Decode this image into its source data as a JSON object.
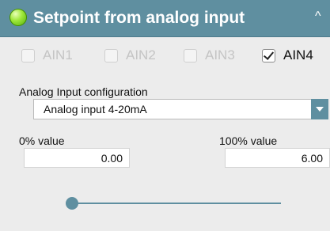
{
  "header": {
    "title": "Setpoint from analog input",
    "status_color": "#8fd82a",
    "collapse_icon": "chevron-up-icon"
  },
  "inputs": [
    {
      "label": "AIN1",
      "checked": false
    },
    {
      "label": "AIN2",
      "checked": false
    },
    {
      "label": "AIN3",
      "checked": false
    },
    {
      "label": "AIN4",
      "checked": true
    }
  ],
  "config": {
    "label": "Analog Input configuration",
    "selected": "Analog input 4-20mA"
  },
  "range": {
    "zero_label": "0% value",
    "zero_value": "0.00",
    "full_label": "100% value",
    "full_value": "6.00"
  },
  "slider": {
    "position": 0
  },
  "colors": {
    "accent": "#5f8fa0",
    "background": "#ececec"
  }
}
